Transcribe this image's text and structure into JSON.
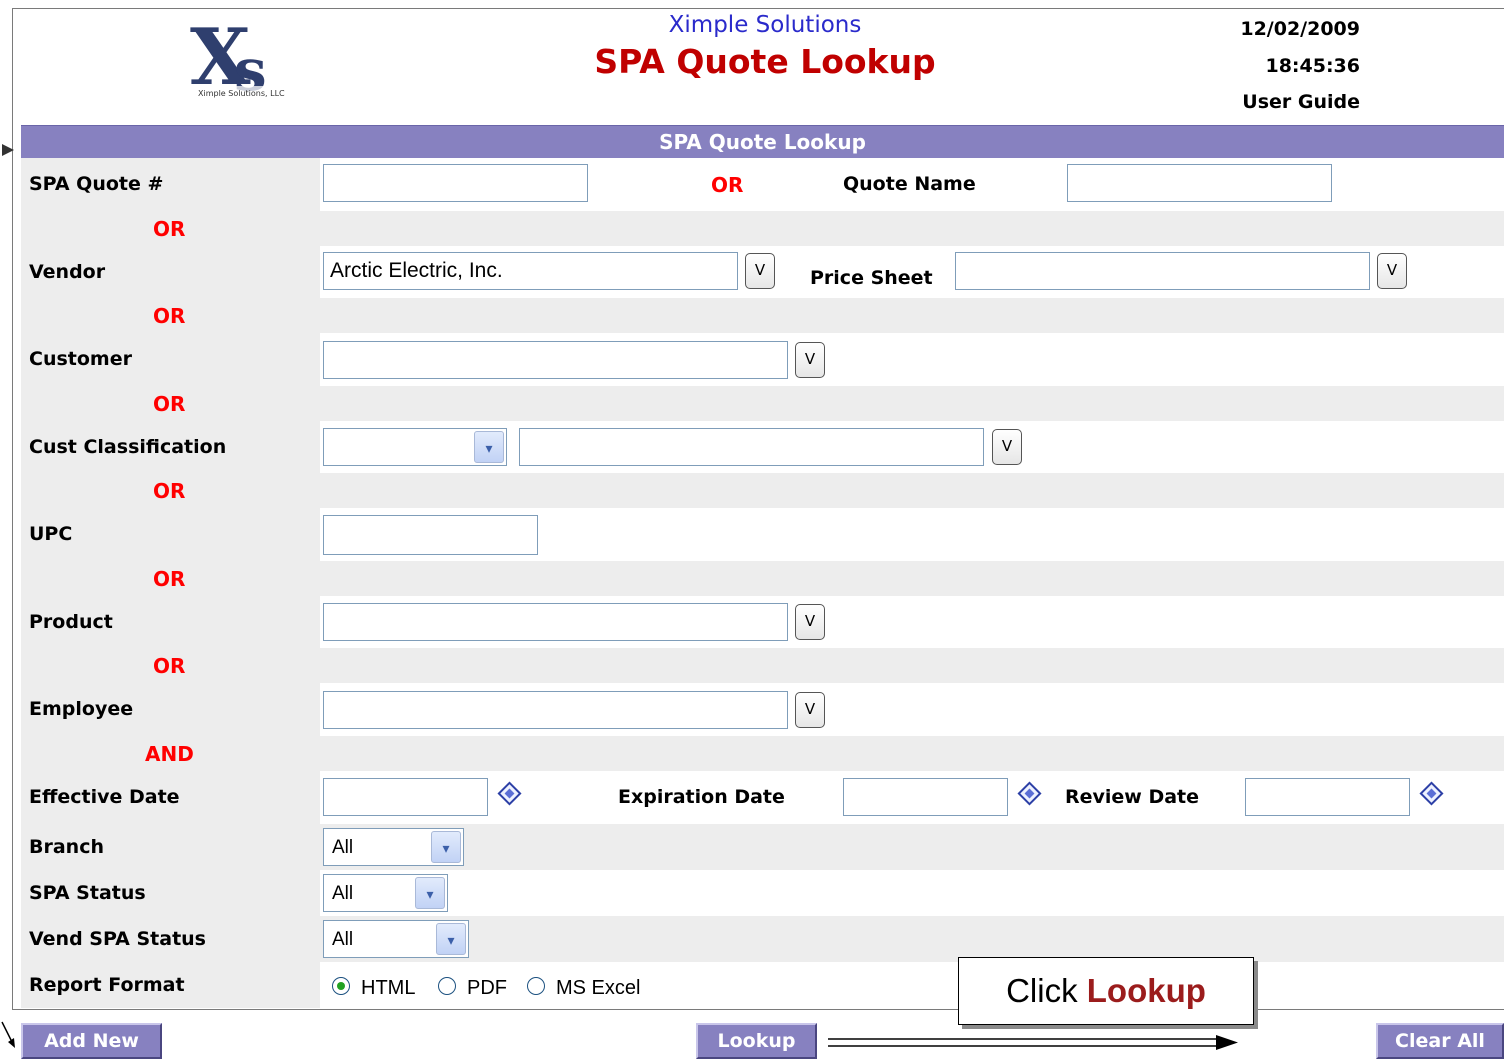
{
  "header": {
    "company": "Ximple Solutions",
    "title": "SPA Quote Lookup",
    "date": "12/02/2009",
    "time": "18:45:36",
    "user_guide": "User Guide",
    "logo_text": "Ximple Solutions, LLC"
  },
  "form": {
    "section_title": "SPA Quote Lookup",
    "or_label": "OR",
    "and_label": "AND",
    "fields": {
      "spa_quote": {
        "label": "SPA Quote #",
        "value": ""
      },
      "quote_name": {
        "label": "Quote Name",
        "value": ""
      },
      "vendor": {
        "label": "Vendor",
        "value": "Arctic Electric, Inc."
      },
      "price_sheet": {
        "label": "Price Sheet",
        "value": ""
      },
      "customer": {
        "label": "Customer",
        "value": ""
      },
      "cust_classification": {
        "label": "Cust Classification",
        "select_value": "",
        "value": ""
      },
      "upc": {
        "label": "UPC",
        "value": ""
      },
      "product": {
        "label": "Product",
        "value": ""
      },
      "employee": {
        "label": "Employee",
        "value": ""
      },
      "effective_date": {
        "label": "Effective Date",
        "value": ""
      },
      "expiration_date": {
        "label": "Expiration Date",
        "value": ""
      },
      "review_date": {
        "label": "Review Date",
        "value": ""
      },
      "branch": {
        "label": "Branch",
        "value": "All"
      },
      "spa_status": {
        "label": "SPA Status",
        "value": "All"
      },
      "vend_spa_status": {
        "label": "Vend SPA Status",
        "value": "All"
      },
      "report_format": {
        "label": "Report Format",
        "options": [
          "HTML",
          "PDF",
          "MS Excel"
        ],
        "selected": "HTML"
      }
    },
    "lookup_button_glyph": "V",
    "dropdown_glyph": "▾"
  },
  "buttons": {
    "add_new": "Add New",
    "lookup": "Lookup",
    "clear_all": "Clear All"
  },
  "callout": {
    "prefix": "Click",
    "highlight": "Lookup"
  },
  "colors": {
    "title_bar": "#8781c0",
    "or_text": "#ff0000",
    "company_text": "#2a2acb",
    "title_text": "#c00000"
  }
}
